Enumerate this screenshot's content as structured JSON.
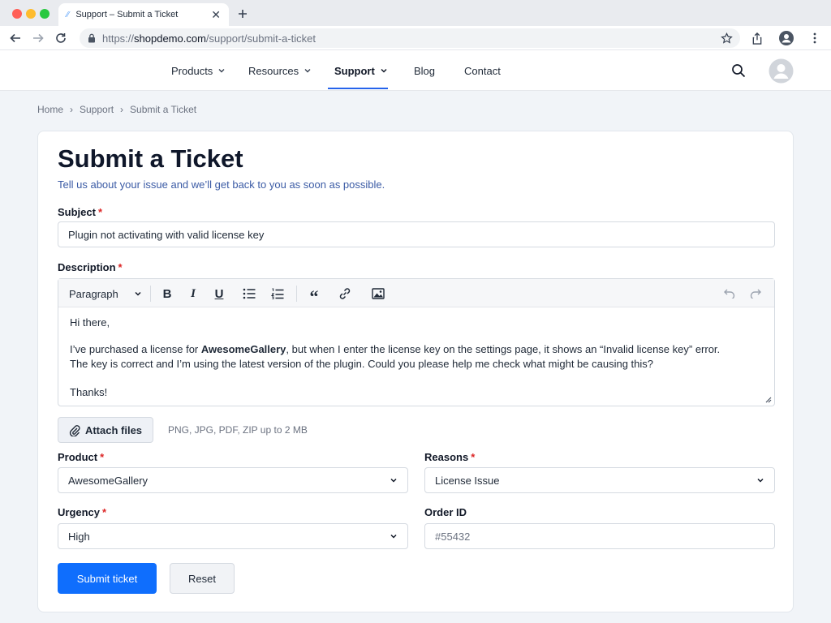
{
  "browser": {
    "tab_title": "Support – Submit a Ticket",
    "url_prefix": "https://",
    "url_domain": "shopdemo.com",
    "url_path": "/support/submit-a-ticket"
  },
  "nav": {
    "items": [
      {
        "label": "Products"
      },
      {
        "label": "Resources"
      },
      {
        "label": "Support"
      },
      {
        "label": "Blog"
      },
      {
        "label": "Contact"
      }
    ],
    "active": "Support"
  },
  "breadcrumb": [
    "Home",
    "Support",
    "Submit a Ticket"
  ],
  "page": {
    "title": "Submit a Ticket",
    "subtitle": "Tell us about your issue and we’ll get back to you as soon as possible."
  },
  "form": {
    "subject_label": "Subject",
    "subject_value": "Plugin not activating with valid license key",
    "description_label": "Description",
    "editor": {
      "format": "Paragraph",
      "lines": {
        "greeting": "Hi there,",
        "p1_before": "I’ve purchased a license for ",
        "p1_bold": "AwesomeGallery",
        "p1_after": ", but when I enter the license key on the settings page, it shows an “Invalid license key” error.",
        "p2": "The key is correct and I’m using the latest version of the plugin. Could you please help me check what might be causing this?",
        "closing": "Thanks!"
      }
    },
    "attach_label": "Attach files",
    "attach_hint": "PNG, JPG, PDF, ZIP up to 2 MB",
    "product_label": "Product",
    "product_value": "AwesomeGallery",
    "reasons_label": "Reasons",
    "reasons_value": "License Issue",
    "urgency_label": "Urgency",
    "urgency_value": "High",
    "order_label": "Order ID",
    "order_placeholder": "#55432",
    "required_mark": "*",
    "submit_label": "Submit ticket",
    "reset_label": "Reset"
  },
  "colors": {
    "primary": "#0f6efd",
    "required": "#dc2626",
    "accent_underline": "#2563eb"
  }
}
